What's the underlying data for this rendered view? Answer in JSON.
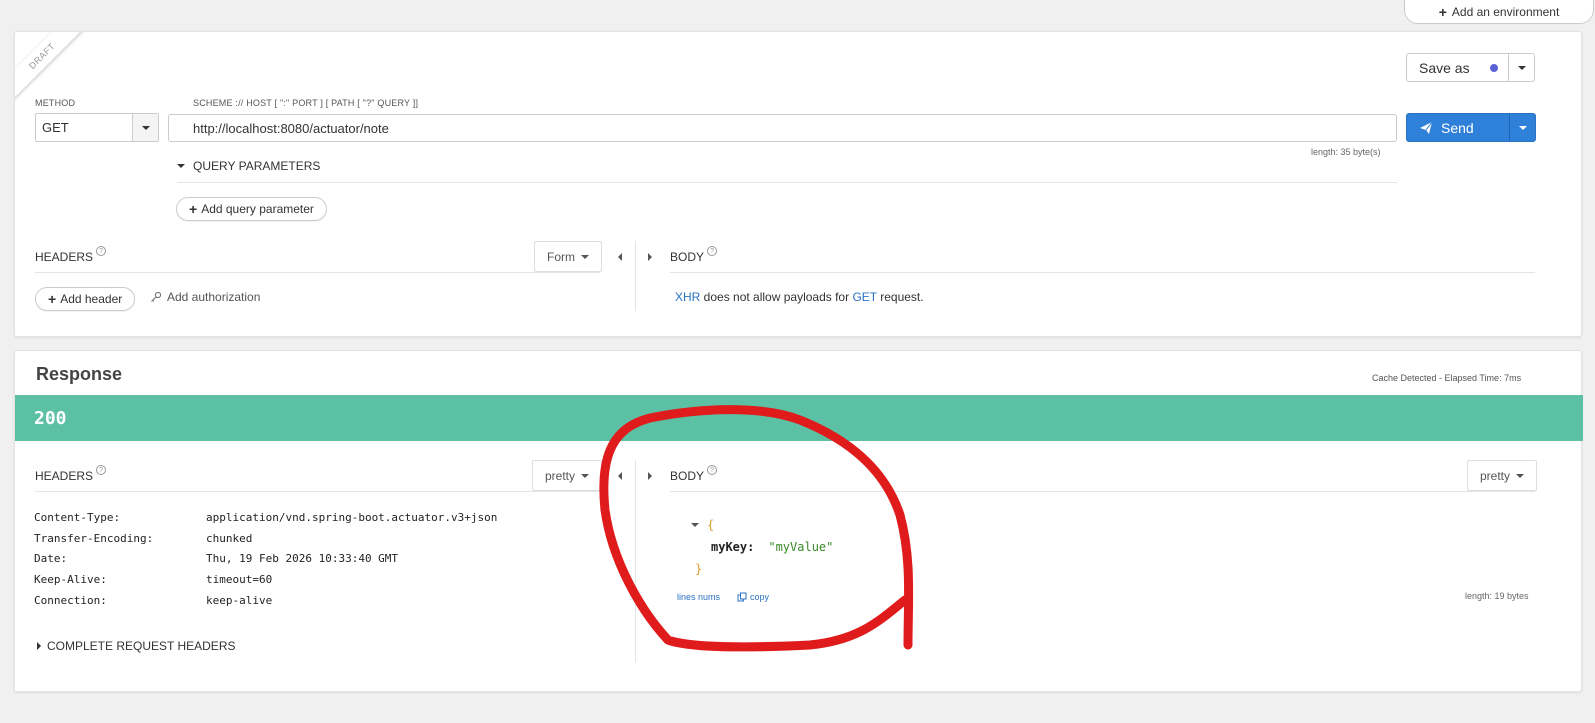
{
  "environment": {
    "add_label": "Add an environment"
  },
  "request": {
    "draft_label": "DRAFT",
    "method_label": "METHOD",
    "method_value": "GET",
    "url_label": "SCHEME :// HOST [ \":\" PORT ] [ PATH [ \"?\" QUERY ]]",
    "url_value": "http://localhost:8080/actuator/note",
    "url_length": "length: 35 byte(s)",
    "save_as_label": "Save as",
    "send_label": "Send",
    "query_params_label": "QUERY PARAMETERS",
    "add_query_param_label": "Add query parameter",
    "headers_label": "HEADERS",
    "headers_format": "Form",
    "add_header_label": "Add header",
    "add_auth_label": "Add authorization",
    "body_label": "BODY",
    "body_note_prefix": "XHR",
    "body_note_middle": " does not allow payloads for ",
    "body_note_method": "GET",
    "body_note_suffix": " request."
  },
  "response": {
    "title": "Response",
    "cache_info": "Cache Detected - Elapsed Time: 7ms",
    "status_code": "200",
    "headers_label": "HEADERS",
    "headers_format": "pretty",
    "body_label": "BODY",
    "body_format": "pretty",
    "headers": [
      {
        "name": "Content-Type:",
        "value": "application/vnd.spring-boot.actuator.v3+json"
      },
      {
        "name": "Transfer-Encoding:",
        "value": "chunked"
      },
      {
        "name": "Date:",
        "value": "Thu, 19 Feb 2026 10:33:40 GMT"
      },
      {
        "name": "Keep-Alive:",
        "value": "timeout=60"
      },
      {
        "name": "Connection:",
        "value": "keep-alive"
      }
    ],
    "complete_headers_label": "COMPLETE REQUEST HEADERS",
    "json": {
      "open": "{",
      "key": "myKey:",
      "value": "\"myValue\"",
      "close": "}"
    },
    "lines_nums_label": "lines nums",
    "copy_label": "copy",
    "body_length": "length: 19 bytes"
  },
  "colors": {
    "send_blue": "#2f80d8",
    "status_green": "#5cc0a5",
    "annotation_red": "#e01b1b",
    "link_blue": "#2a72c2"
  }
}
